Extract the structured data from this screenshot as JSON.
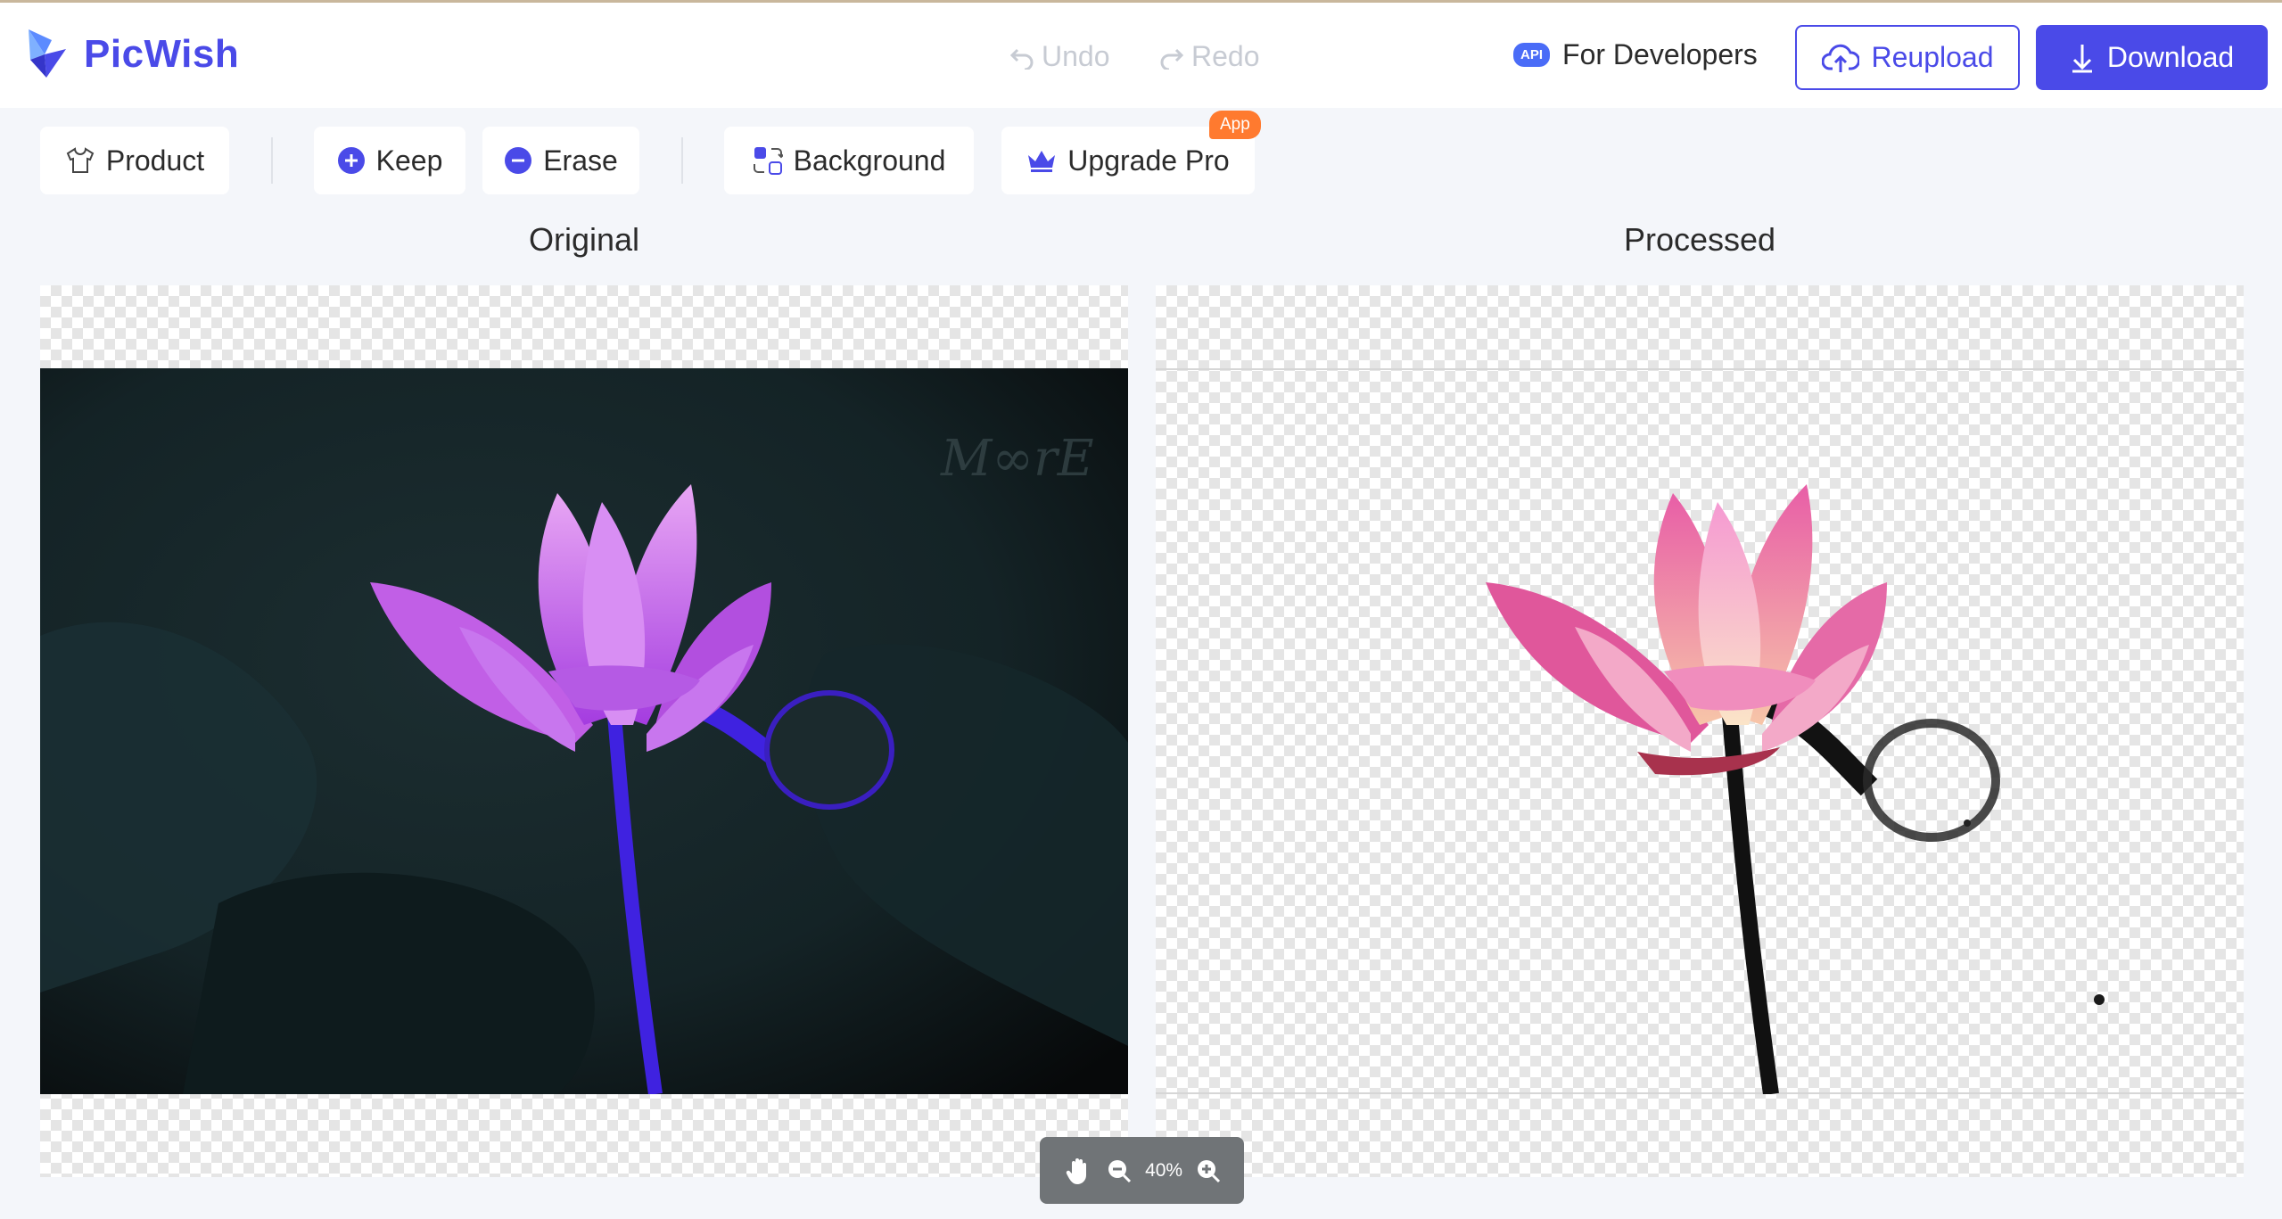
{
  "app": {
    "name": "PicWish",
    "brand_color": "#4a4ae8"
  },
  "header": {
    "undo_label": "Undo",
    "redo_label": "Redo",
    "api_badge": "API",
    "developers_label": "For Developers",
    "reupload_label": "Reupload",
    "download_label": "Download"
  },
  "toolbar": {
    "product_label": "Product",
    "keep_label": "Keep",
    "erase_label": "Erase",
    "background_label": "Background",
    "upgrade_label": "Upgrade Pro",
    "app_badge": "App"
  },
  "panels": {
    "original_label": "Original",
    "processed_label": "Processed"
  },
  "zoom": {
    "level": "40%"
  },
  "icons": [
    "logo-icon",
    "undo-icon",
    "redo-icon",
    "api-icon",
    "cloud-upload-icon",
    "download-arrow-icon",
    "shirt-icon",
    "plus-circle-icon",
    "minus-circle-icon",
    "background-swap-icon",
    "crown-icon",
    "hand-icon",
    "zoom-out-icon",
    "zoom-in-icon"
  ]
}
